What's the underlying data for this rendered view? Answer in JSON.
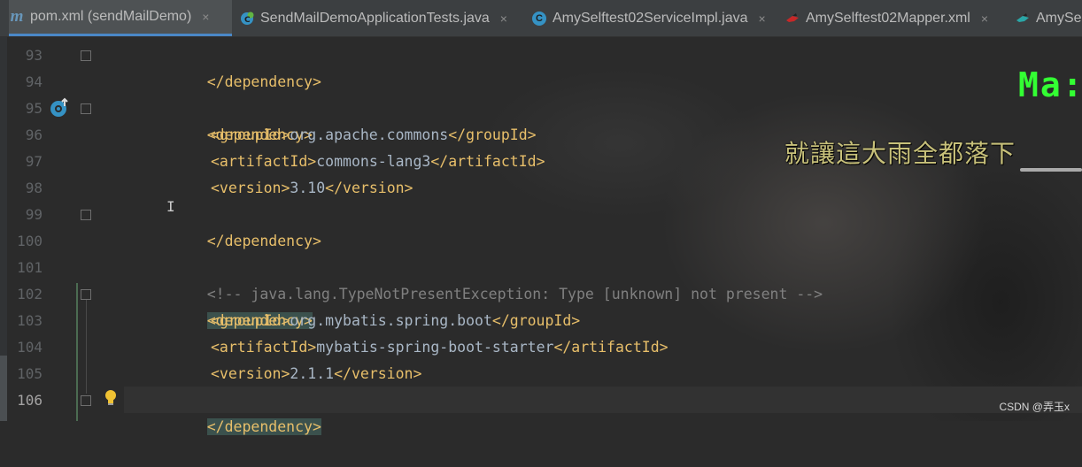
{
  "tabs": [
    {
      "label": "pom.xml (sendMailDemo)",
      "icon": "maven-m-icon",
      "active": true
    },
    {
      "label": "SendMailDemoApplicationTests.java",
      "icon": "spring-test-class-icon"
    },
    {
      "label": "AmySelftest02ServiceImpl.java",
      "icon": "class-c-icon"
    },
    {
      "label": "AmySelftest02Mapper.xml",
      "icon": "mybatis-bird-icon"
    },
    {
      "label": "AmySelf",
      "icon": "mybatis-bird-icon"
    }
  ],
  "close_glyph": "×",
  "lines": [
    {
      "n": "93"
    },
    {
      "n": "94"
    },
    {
      "n": "95"
    },
    {
      "n": "96"
    },
    {
      "n": "97"
    },
    {
      "n": "98"
    },
    {
      "n": "99"
    },
    {
      "n": "100"
    },
    {
      "n": "101"
    },
    {
      "n": "102"
    },
    {
      "n": "103"
    },
    {
      "n": "104"
    },
    {
      "n": "105"
    },
    {
      "n": "106"
    }
  ],
  "code": {
    "l93": {
      "a": "</dependency>"
    },
    "l95": {
      "a": "<dependency>"
    },
    "l96": {
      "a": "<groupId>",
      "b": "org.apache.commons",
      "c": "</groupId>"
    },
    "l97": {
      "a": "<artifactId>",
      "b": "commons-lang3",
      "c": "</artifactId>"
    },
    "l98": {
      "a": "<version>",
      "b": "3.10",
      "c": "</version>"
    },
    "l99": {
      "a": "</dependency>"
    },
    "l101": {
      "a": "<!-- java.lang.TypeNotPresentException: Type [unknown] not present -->"
    },
    "l102": {
      "a": "<dependency>"
    },
    "l103": {
      "a": "<groupId>",
      "b": "org.mybatis.spring.boot",
      "c": "</groupId>"
    },
    "l104": {
      "a": "<artifactId>",
      "b": "mybatis-spring-boot-starter",
      "c": "</artifactId>"
    },
    "l105": {
      "a": "<version>",
      "b": "2.1.1",
      "c": "</version>"
    },
    "l106": {
      "a": "</dependency>"
    }
  },
  "overlay": {
    "mag_text": "Ma:",
    "lyric": "就讓這大雨全都落下"
  },
  "watermark": "CSDN @弄玉x",
  "colors": {
    "tag": "#e8bf6a",
    "text": "#a9b7c6",
    "comment": "#808080",
    "background": "#2b2b2b"
  }
}
